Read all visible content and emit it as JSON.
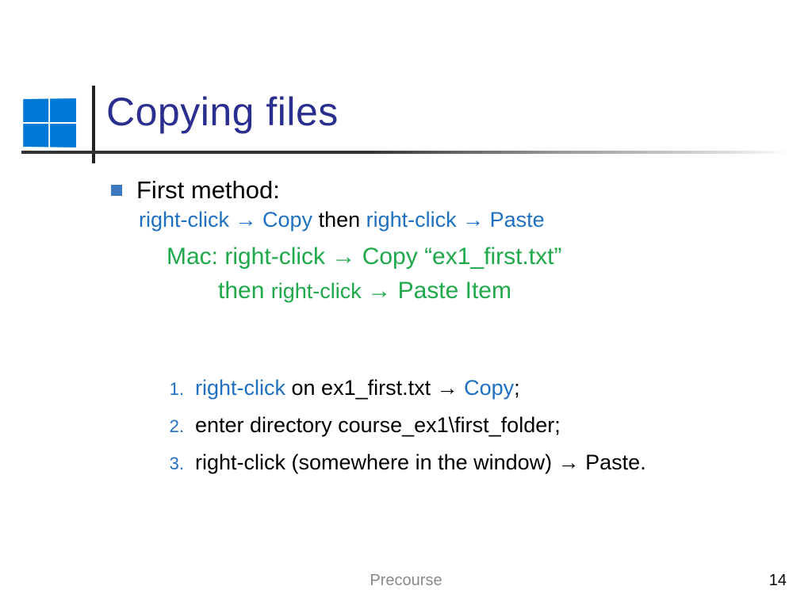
{
  "title": "Copying files",
  "bullet_main": "First method:",
  "sub_line": {
    "p1": "right-click ",
    "arrow1": "→",
    "p2": " Copy ",
    "mid": "then ",
    "p3": "right-click ",
    "arrow2": "→",
    "p4": " Paste"
  },
  "mac": {
    "line1_a": "Mac: right-click ",
    "line1_arrow": "→",
    "line1_b": " Copy “ex1_first.txt”",
    "line2_a": "then ",
    "line2_b": "right-click ",
    "line2_arrow": "→",
    "line2_c": " Paste Item"
  },
  "steps": [
    {
      "num": "1.",
      "a": "right-click",
      "b": " on ex1_first.txt ",
      "arrow": "→",
      "c": " Copy",
      "d": ";"
    },
    {
      "num": "2.",
      "text": "enter directory course_ex1\\first_folder;"
    },
    {
      "num": "3.",
      "a": "right-click (somewhere in the window) ",
      "arrow": "→",
      "b": " Paste."
    }
  ],
  "footer": {
    "center": "Precourse",
    "page": "14"
  }
}
